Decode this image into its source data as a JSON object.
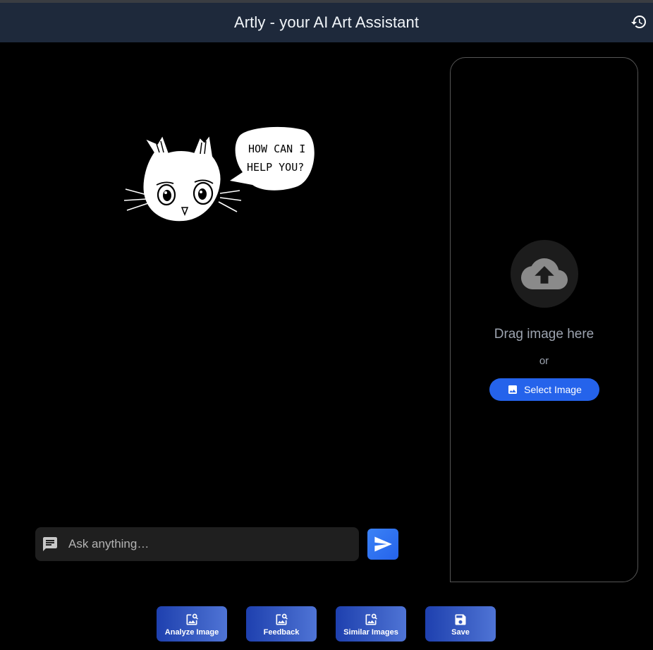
{
  "header": {
    "title": "Artly - your AI Art Assistant"
  },
  "mascot": {
    "speech": [
      "HOW CAN I",
      "HELP YOU?"
    ]
  },
  "chat": {
    "placeholder": "Ask anything…"
  },
  "upload": {
    "drag_text": "Drag image here",
    "or_text": "or",
    "select_label": "Select Image"
  },
  "actions": [
    {
      "label": "Analyze Image",
      "icon": "image-search-icon"
    },
    {
      "label": "Feedback",
      "icon": "image-search-icon"
    },
    {
      "label": "Similar Images",
      "icon": "image-search-icon"
    },
    {
      "label": "Save",
      "icon": "save-icon"
    }
  ],
  "colors": {
    "header_bg": "#1e293b",
    "accent": "#2563eb",
    "background": "#000000"
  }
}
